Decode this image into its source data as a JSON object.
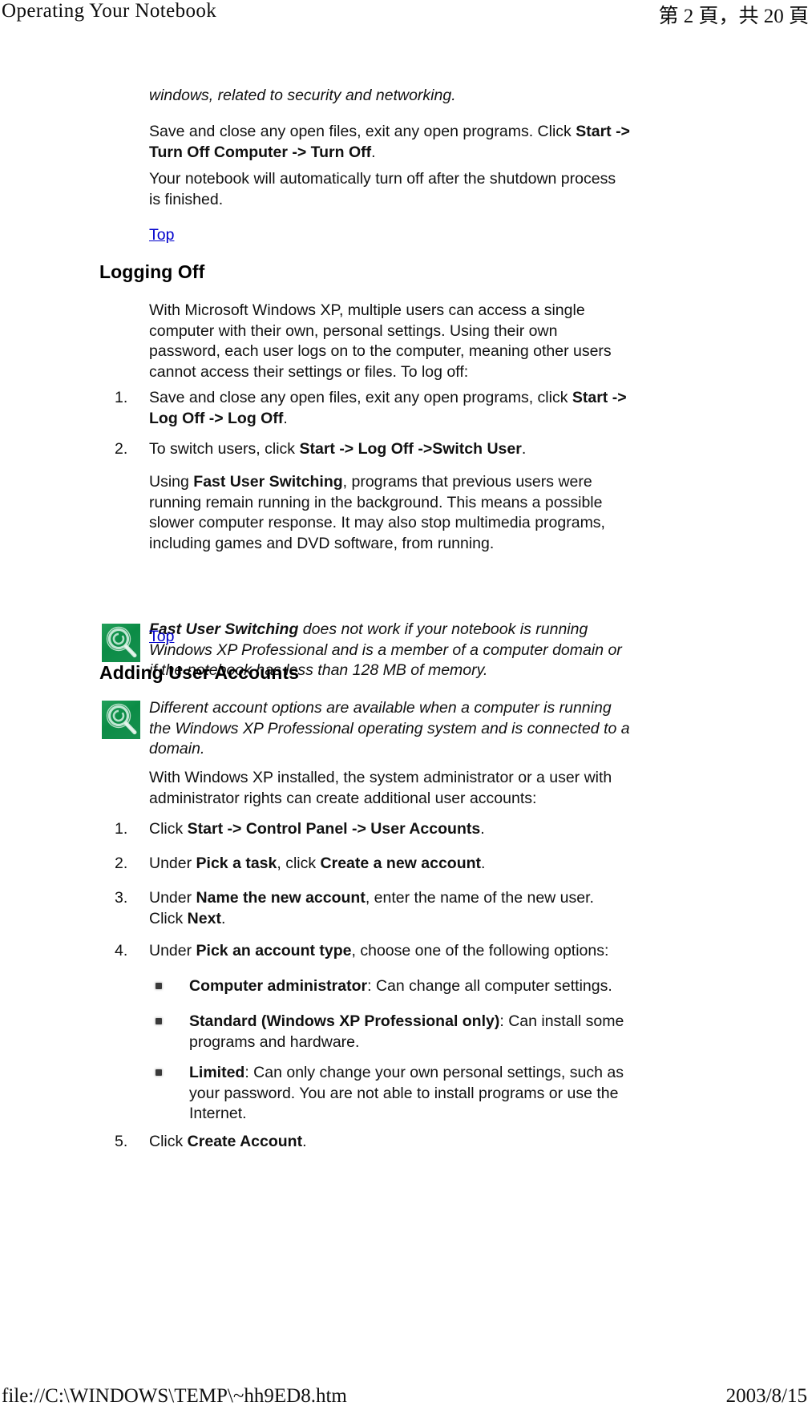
{
  "header": {
    "left_title": "Operating Your Notebook",
    "page_indicator": "第 2 頁，共 20 頁"
  },
  "footer": {
    "file_path": "file://C:\\WINDOWS\\TEMP\\~hh9ED8.htm",
    "date": "2003/8/15"
  },
  "content": {
    "intro_italic": "windows, related to security and networking.",
    "shutdown_para_pre": "Save and close any open files, exit any open programs. Click ",
    "shutdown_para_bold": "Start -> Turn Off Computer -> Turn Off",
    "shutdown_para_post": ".",
    "autoturnoff_para": "Your notebook will automatically turn off after the shutdown process is finished.",
    "top_link_1": "Top",
    "heading_logging_off": "Logging Off",
    "logging_off_intro": "With Microsoft Windows XP, multiple users can access a single computer with their own, personal settings. Using their own password, each user logs on to the computer, meaning other users cannot access their settings or files. To log off:",
    "logoff_steps": [
      {
        "number": "1.",
        "pre": "Save and close any open files, exit any open programs, click ",
        "bold": "Start -> Log Off -> Log Off",
        "post": "."
      },
      {
        "number": "2.",
        "pre": "To switch users, click ",
        "bold": "Start -> Log Off ->Switch User",
        "post": "."
      }
    ],
    "fast_switching_para_pre": "Using ",
    "fast_switching_para_bold": "Fast User Switching",
    "fast_switching_para_post": ", programs that previous users were running remain running in the background. This means a possible slower computer response. It may also stop multimedia programs, including games and DVD software, from running.",
    "note_1_bold": "Fast User Switching",
    "note_1_rest": " does not work if your notebook is running Windows XP Professional and is a member of a computer domain or if the notebook has less than 128 MB of memory.",
    "top_link_2": "Top",
    "heading_adding_user_accounts": "Adding User Accounts",
    "note_2_text": "Different account options are available when a computer is running the Windows XP Professional operating system and is connected to a domain.",
    "admin_intro": "With Windows XP installed, the system administrator or a user with administrator rights can create additional user accounts:",
    "account_steps": [
      {
        "number": "1.",
        "pre": "Click ",
        "bold": "Start -> Control Panel -> User Accounts",
        "post": "."
      },
      {
        "number": "2.",
        "pre": "Under ",
        "bold": "Pick a task",
        "mid": ", click ",
        "bold2": "Create a new account",
        "post": "."
      },
      {
        "number": "3.",
        "pre": "Under ",
        "bold": "Name the new account",
        "mid": ", enter the name of the new user. Click ",
        "bold2": "Next",
        "post": "."
      },
      {
        "number": "4.",
        "pre": "Under ",
        "bold": "Pick an account type",
        "post": ", choose one of the following options:"
      },
      {
        "number": "5.",
        "pre": "Click ",
        "bold": "Create Account",
        "post": "."
      }
    ],
    "account_type_bullets": [
      {
        "bold": "Computer administrator",
        "rest": ": Can change all computer settings."
      },
      {
        "bold": "Standard (Windows XP Professional only)",
        "rest": ": Can install some programs and hardware."
      },
      {
        "bold": "Limited",
        "rest": ": Can only change your own personal settings, such as your password. You are not able to install programs or use the Internet."
      }
    ]
  },
  "colors": {
    "link": "#0000CC",
    "note_icon_green": "#0B8C46",
    "text": "#111111"
  }
}
